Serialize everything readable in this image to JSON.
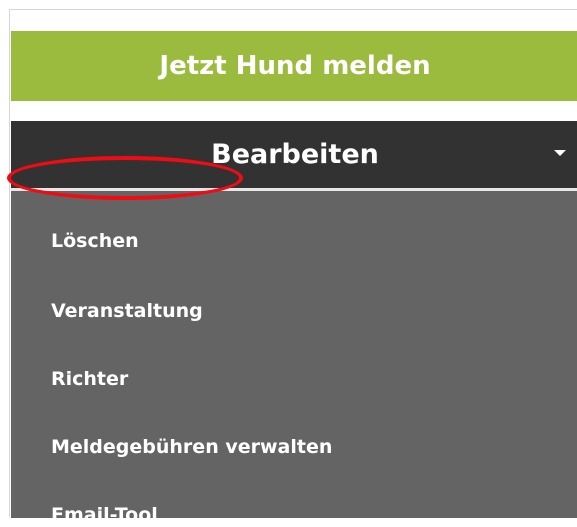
{
  "report_button": {
    "label": "Jetzt Hund melden",
    "color": "#9bbb3f"
  },
  "edit_menu": {
    "header_label": "Bearbeiten",
    "header_color": "#323232",
    "panel_color": "#646464",
    "items": [
      {
        "label": "Löschen"
      },
      {
        "label": "Veranstaltung",
        "highlighted": true
      },
      {
        "label": "Richter"
      },
      {
        "label": "Meldegebühren verwalten"
      },
      {
        "label": "Email-Tool"
      }
    ]
  },
  "icons": {
    "dropdown": "caret-down-icon"
  },
  "annotation": {
    "type": "red-ellipse-highlight",
    "target": "Veranstaltung",
    "color": "#f20b13"
  }
}
